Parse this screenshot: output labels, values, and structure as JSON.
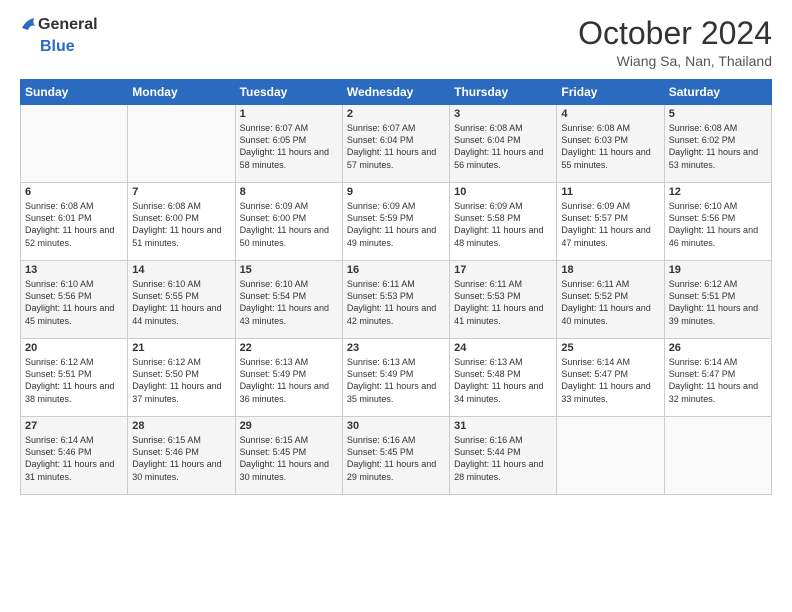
{
  "header": {
    "logo_general": "General",
    "logo_blue": "Blue",
    "title": "October 2024",
    "subtitle": "Wiang Sa, Nan, Thailand"
  },
  "days_of_week": [
    "Sunday",
    "Monday",
    "Tuesday",
    "Wednesday",
    "Thursday",
    "Friday",
    "Saturday"
  ],
  "weeks": [
    [
      {
        "day": "",
        "sunrise": "",
        "sunset": "",
        "daylight": ""
      },
      {
        "day": "",
        "sunrise": "",
        "sunset": "",
        "daylight": ""
      },
      {
        "day": "1",
        "sunrise": "Sunrise: 6:07 AM",
        "sunset": "Sunset: 6:05 PM",
        "daylight": "Daylight: 11 hours and 58 minutes."
      },
      {
        "day": "2",
        "sunrise": "Sunrise: 6:07 AM",
        "sunset": "Sunset: 6:04 PM",
        "daylight": "Daylight: 11 hours and 57 minutes."
      },
      {
        "day": "3",
        "sunrise": "Sunrise: 6:08 AM",
        "sunset": "Sunset: 6:04 PM",
        "daylight": "Daylight: 11 hours and 56 minutes."
      },
      {
        "day": "4",
        "sunrise": "Sunrise: 6:08 AM",
        "sunset": "Sunset: 6:03 PM",
        "daylight": "Daylight: 11 hours and 55 minutes."
      },
      {
        "day": "5",
        "sunrise": "Sunrise: 6:08 AM",
        "sunset": "Sunset: 6:02 PM",
        "daylight": "Daylight: 11 hours and 53 minutes."
      }
    ],
    [
      {
        "day": "6",
        "sunrise": "Sunrise: 6:08 AM",
        "sunset": "Sunset: 6:01 PM",
        "daylight": "Daylight: 11 hours and 52 minutes."
      },
      {
        "day": "7",
        "sunrise": "Sunrise: 6:08 AM",
        "sunset": "Sunset: 6:00 PM",
        "daylight": "Daylight: 11 hours and 51 minutes."
      },
      {
        "day": "8",
        "sunrise": "Sunrise: 6:09 AM",
        "sunset": "Sunset: 6:00 PM",
        "daylight": "Daylight: 11 hours and 50 minutes."
      },
      {
        "day": "9",
        "sunrise": "Sunrise: 6:09 AM",
        "sunset": "Sunset: 5:59 PM",
        "daylight": "Daylight: 11 hours and 49 minutes."
      },
      {
        "day": "10",
        "sunrise": "Sunrise: 6:09 AM",
        "sunset": "Sunset: 5:58 PM",
        "daylight": "Daylight: 11 hours and 48 minutes."
      },
      {
        "day": "11",
        "sunrise": "Sunrise: 6:09 AM",
        "sunset": "Sunset: 5:57 PM",
        "daylight": "Daylight: 11 hours and 47 minutes."
      },
      {
        "day": "12",
        "sunrise": "Sunrise: 6:10 AM",
        "sunset": "Sunset: 5:56 PM",
        "daylight": "Daylight: 11 hours and 46 minutes."
      }
    ],
    [
      {
        "day": "13",
        "sunrise": "Sunrise: 6:10 AM",
        "sunset": "Sunset: 5:56 PM",
        "daylight": "Daylight: 11 hours and 45 minutes."
      },
      {
        "day": "14",
        "sunrise": "Sunrise: 6:10 AM",
        "sunset": "Sunset: 5:55 PM",
        "daylight": "Daylight: 11 hours and 44 minutes."
      },
      {
        "day": "15",
        "sunrise": "Sunrise: 6:10 AM",
        "sunset": "Sunset: 5:54 PM",
        "daylight": "Daylight: 11 hours and 43 minutes."
      },
      {
        "day": "16",
        "sunrise": "Sunrise: 6:11 AM",
        "sunset": "Sunset: 5:53 PM",
        "daylight": "Daylight: 11 hours and 42 minutes."
      },
      {
        "day": "17",
        "sunrise": "Sunrise: 6:11 AM",
        "sunset": "Sunset: 5:53 PM",
        "daylight": "Daylight: 11 hours and 41 minutes."
      },
      {
        "day": "18",
        "sunrise": "Sunrise: 6:11 AM",
        "sunset": "Sunset: 5:52 PM",
        "daylight": "Daylight: 11 hours and 40 minutes."
      },
      {
        "day": "19",
        "sunrise": "Sunrise: 6:12 AM",
        "sunset": "Sunset: 5:51 PM",
        "daylight": "Daylight: 11 hours and 39 minutes."
      }
    ],
    [
      {
        "day": "20",
        "sunrise": "Sunrise: 6:12 AM",
        "sunset": "Sunset: 5:51 PM",
        "daylight": "Daylight: 11 hours and 38 minutes."
      },
      {
        "day": "21",
        "sunrise": "Sunrise: 6:12 AM",
        "sunset": "Sunset: 5:50 PM",
        "daylight": "Daylight: 11 hours and 37 minutes."
      },
      {
        "day": "22",
        "sunrise": "Sunrise: 6:13 AM",
        "sunset": "Sunset: 5:49 PM",
        "daylight": "Daylight: 11 hours and 36 minutes."
      },
      {
        "day": "23",
        "sunrise": "Sunrise: 6:13 AM",
        "sunset": "Sunset: 5:49 PM",
        "daylight": "Daylight: 11 hours and 35 minutes."
      },
      {
        "day": "24",
        "sunrise": "Sunrise: 6:13 AM",
        "sunset": "Sunset: 5:48 PM",
        "daylight": "Daylight: 11 hours and 34 minutes."
      },
      {
        "day": "25",
        "sunrise": "Sunrise: 6:14 AM",
        "sunset": "Sunset: 5:47 PM",
        "daylight": "Daylight: 11 hours and 33 minutes."
      },
      {
        "day": "26",
        "sunrise": "Sunrise: 6:14 AM",
        "sunset": "Sunset: 5:47 PM",
        "daylight": "Daylight: 11 hours and 32 minutes."
      }
    ],
    [
      {
        "day": "27",
        "sunrise": "Sunrise: 6:14 AM",
        "sunset": "Sunset: 5:46 PM",
        "daylight": "Daylight: 11 hours and 31 minutes."
      },
      {
        "day": "28",
        "sunrise": "Sunrise: 6:15 AM",
        "sunset": "Sunset: 5:46 PM",
        "daylight": "Daylight: 11 hours and 30 minutes."
      },
      {
        "day": "29",
        "sunrise": "Sunrise: 6:15 AM",
        "sunset": "Sunset: 5:45 PM",
        "daylight": "Daylight: 11 hours and 30 minutes."
      },
      {
        "day": "30",
        "sunrise": "Sunrise: 6:16 AM",
        "sunset": "Sunset: 5:45 PM",
        "daylight": "Daylight: 11 hours and 29 minutes."
      },
      {
        "day": "31",
        "sunrise": "Sunrise: 6:16 AM",
        "sunset": "Sunset: 5:44 PM",
        "daylight": "Daylight: 11 hours and 28 minutes."
      },
      {
        "day": "",
        "sunrise": "",
        "sunset": "",
        "daylight": ""
      },
      {
        "day": "",
        "sunrise": "",
        "sunset": "",
        "daylight": ""
      }
    ]
  ]
}
